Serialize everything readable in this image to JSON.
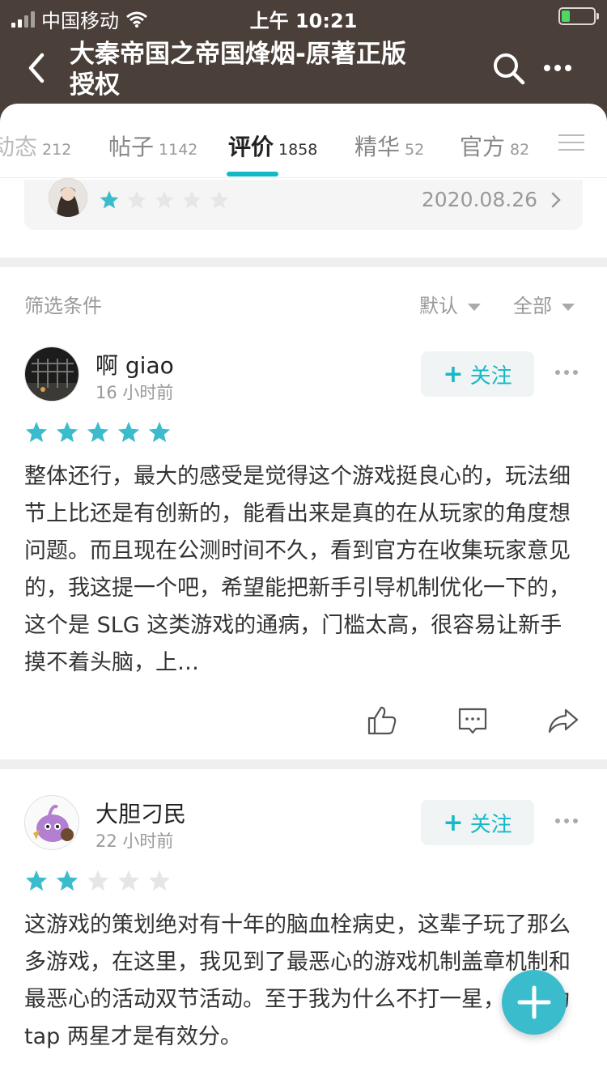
{
  "status_bar": {
    "carrier": "中国移动",
    "time": "上午 10:21"
  },
  "header": {
    "title": "大秦帝国之帝国烽烟-原著正版授权"
  },
  "tabs": [
    {
      "label": "动态",
      "count": "212"
    },
    {
      "label": "帖子",
      "count": "1142"
    },
    {
      "label": "评价",
      "count": "1858"
    },
    {
      "label": "精华",
      "count": "52"
    },
    {
      "label": "官方",
      "count": "82"
    }
  ],
  "my_rating": {
    "stars": 1,
    "date": "2020.08.26"
  },
  "filter": {
    "label": "筛选条件",
    "sort": "默认",
    "scope": "全部"
  },
  "follow_label": "关注",
  "reviews": [
    {
      "user": "啊 giao",
      "time": "16 小时前",
      "stars": 5,
      "text": "整体还行，最大的感受是觉得这个游戏挺良心的，玩法细节上比还是有创新的，能看出来是真的在从玩家的角度想问题。而且现在公测时间不久，看到官方在收集玩家意见的，我这提一个吧，希望能把新手引导机制优化一下的，这个是 SLG 这类游戏的通病，门槛太高，很容易让新手摸不着头脑，上…"
    },
    {
      "user": "大胆刁民",
      "time": "22 小时前",
      "stars": 2,
      "text": "这游戏的策划绝对有十年的脑血栓病史，这辈子玩了那么多游戏，在这里，我见到了最恶心的游戏机制盖章机制和最恶心的活动双节活动。至于我为什么不打一星，是因为 tap 两星才是有效分。"
    }
  ],
  "colors": {
    "header_bg": "#4a3f39",
    "accent": "#14b9c8",
    "star_on": "#3bbccc",
    "star_off": "#e6e6e6"
  }
}
